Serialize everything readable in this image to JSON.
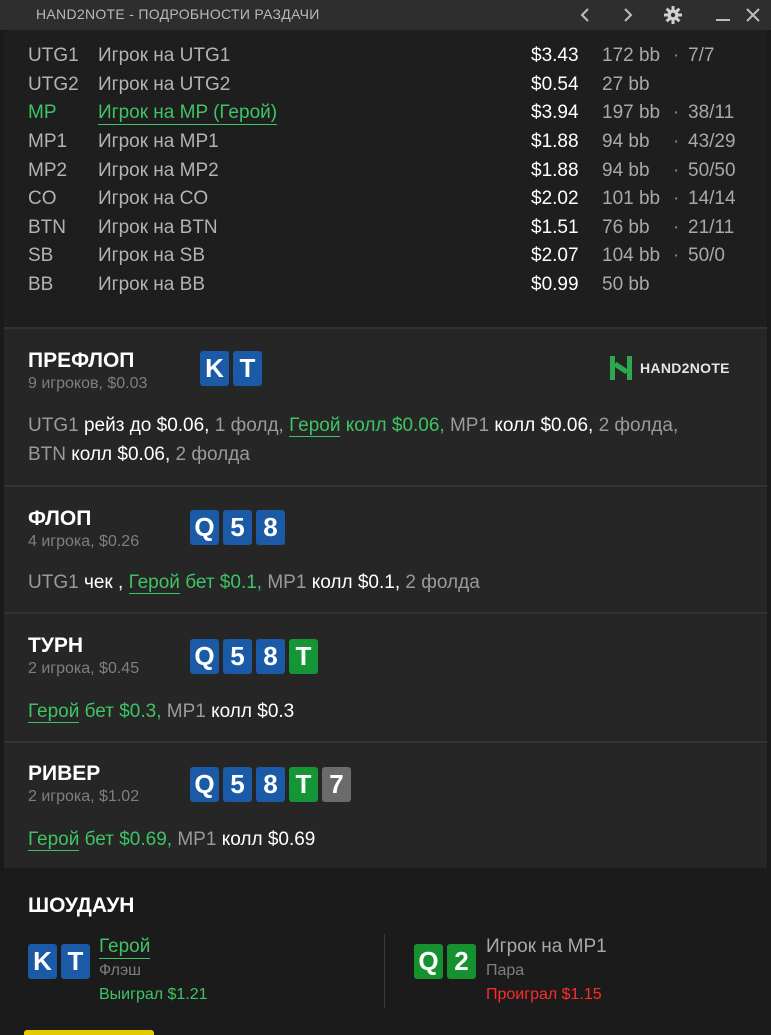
{
  "window": {
    "title": "HAND2NOTE - ПОДРОБНОСТИ РАЗДАЧИ"
  },
  "players": [
    {
      "pos": "UTG1",
      "name": "Игрок на UTG1",
      "stack": "$3.43",
      "bb": "172 bb",
      "dot": "·",
      "stat": "7/7",
      "hero": false
    },
    {
      "pos": "UTG2",
      "name": "Игрок на UTG2",
      "stack": "$0.54",
      "bb": "27 bb",
      "dot": "",
      "stat": "",
      "hero": false
    },
    {
      "pos": "MP",
      "name": "Игрок на MP (Герой)",
      "stack": "$3.94",
      "bb": "197 bb",
      "dot": "·",
      "stat": "38/11",
      "hero": true
    },
    {
      "pos": "MP1",
      "name": "Игрок на MP1",
      "stack": "$1.88",
      "bb": "94 bb",
      "dot": "·",
      "stat": "43/29",
      "hero": false
    },
    {
      "pos": "MP2",
      "name": "Игрок на MP2",
      "stack": "$1.88",
      "bb": "94 bb",
      "dot": "·",
      "stat": "50/50",
      "hero": false
    },
    {
      "pos": "CO",
      "name": "Игрок на CO",
      "stack": "$2.02",
      "bb": "101 bb",
      "dot": "·",
      "stat": "14/14",
      "hero": false
    },
    {
      "pos": "BTN",
      "name": "Игрок на BTN",
      "stack": "$1.51",
      "bb": "76 bb",
      "dot": "·",
      "stat": "21/11",
      "hero": false
    },
    {
      "pos": "SB",
      "name": "Игрок на SB",
      "stack": "$2.07",
      "bb": "104 bb",
      "dot": "·",
      "stat": "50/0",
      "hero": false
    },
    {
      "pos": "BB",
      "name": "Игрок на BB",
      "stack": "$0.99",
      "bb": "50 bb",
      "dot": "",
      "stat": "",
      "hero": false
    }
  ],
  "preflop": {
    "name": "ПРЕФЛОП",
    "sub": "9 игроков, $0.03",
    "cards": [
      "K",
      "T"
    ],
    "logo": "HAND2NOTE",
    "line1": {
      "p1": "UTG1",
      "a1": "рейз до $0.06,",
      "f1": "1 фолд,",
      "hero": "Герой",
      "heroact": "колл $0.06,",
      "p2": "MP1",
      "a2": "колл $0.06,",
      "f2": "2 фолда,"
    },
    "line2": {
      "p1": "BTN",
      "a1": "колл $0.06,",
      "f1": "2 фолда"
    }
  },
  "flop": {
    "name": "ФЛОП",
    "sub": "4 игрока, $0.26",
    "cards": [
      "Q",
      "5",
      "8"
    ],
    "line": {
      "p1": "UTG1",
      "a1": "чек ,",
      "hero": "Герой",
      "heroact": "бет $0.1,",
      "p2": "MP1",
      "a2": "колл $0.1,",
      "f2": "2 фолда"
    }
  },
  "turn": {
    "name": "ТУРН",
    "sub": "2 игрока, $0.45",
    "cards": [
      "Q",
      "5",
      "8",
      "T"
    ],
    "line": {
      "hero": "Герой",
      "heroact": "бет $0.3,",
      "p2": "MP1",
      "a2": "колл $0.3"
    }
  },
  "river": {
    "name": "РИВЕР",
    "sub": "2 игрока, $1.02",
    "cards": [
      "Q",
      "5",
      "8",
      "T",
      "7"
    ],
    "line": {
      "hero": "Герой",
      "heroact": "бет $0.69,",
      "p2": "MP1",
      "a2": "колл $0.69"
    }
  },
  "showdown": {
    "name": "ШОУДАУН",
    "left": {
      "cards": [
        "K",
        "T"
      ],
      "name": "Герой",
      "hand": "Флэш",
      "result": "Выиграл $1.21"
    },
    "right": {
      "cards": [
        "Q",
        "2"
      ],
      "name": "Игрок на MP1",
      "hand": "Пара",
      "result": "Проиграл $1.15"
    }
  },
  "colors": {
    "hero_green": "#3ec463",
    "lose_red": "#ff2b2b",
    "card_blue": "#1a5aa7",
    "card_green": "#149636",
    "card_gray": "#6b6b6b"
  },
  "icons": [
    "prev-arrow-icon",
    "next-arrow-icon",
    "settings-gear-icon",
    "minimize-icon",
    "close-icon",
    "hand2note-logo-icon"
  ]
}
